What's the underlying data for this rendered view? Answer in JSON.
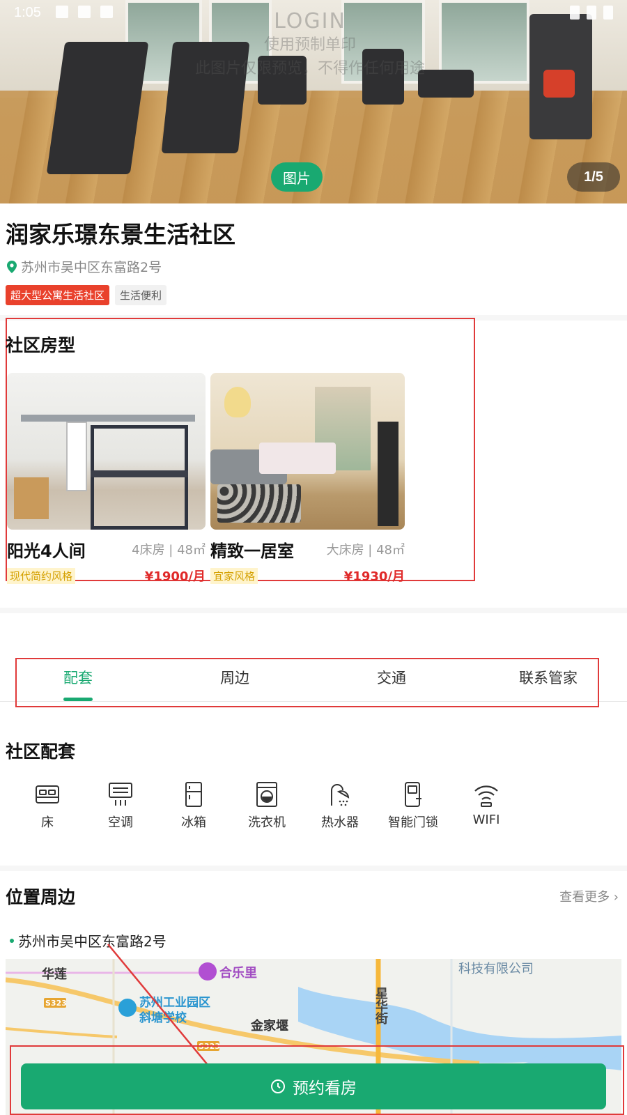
{
  "status_bar": {
    "time": "1:05"
  },
  "hero": {
    "watermark_line1": "LOGIN",
    "watermark_line2": "使用预制单印",
    "watermark_line3": "此图片仅限预览，不得作任何用途",
    "photo_label": "图片",
    "counter": "1/5"
  },
  "property": {
    "name": "润家乐璟东景生活社区",
    "address": "苏州市吴中区东富路2号",
    "tags": [
      "超大型公寓生活社区",
      "生活便利"
    ]
  },
  "room_types": {
    "title": "社区房型",
    "rooms": [
      {
        "name": "阳光4人间",
        "spec": "4床房 | 48㎡",
        "style": "现代简约风格",
        "price": "¥1900/月"
      },
      {
        "name": "精致一居室",
        "spec": "大床房 | 48㎡",
        "style": "宜家风格",
        "price": "¥1930/月"
      }
    ]
  },
  "tabs": [
    "配套",
    "周边",
    "交通",
    "联系管家"
  ],
  "facilities": {
    "title": "社区配套",
    "items": [
      {
        "label": "床",
        "icon": "bed-icon"
      },
      {
        "label": "空调",
        "icon": "air-conditioner-icon"
      },
      {
        "label": "冰箱",
        "icon": "fridge-icon"
      },
      {
        "label": "洗衣机",
        "icon": "washing-machine-icon"
      },
      {
        "label": "热水器",
        "icon": "shower-icon"
      },
      {
        "label": "智能门锁",
        "icon": "smart-lock-icon"
      },
      {
        "label": "WIFI",
        "icon": "wifi-icon"
      }
    ]
  },
  "location": {
    "title": "位置周边",
    "see_more": "查看更多 ›",
    "address": "苏州市吴中区东富路2号",
    "map_labels": {
      "huali": "华莲",
      "helelli": "合乐里",
      "company": "科技有限公司",
      "school_line1": "苏州工业园区",
      "school_line2": "斜塘学校",
      "jinjiayan": "金家堰",
      "xinghua": "星华街",
      "road1": "S323",
      "road2": "S323"
    }
  },
  "booking": {
    "label": "预约看房"
  },
  "colors": {
    "brand_green": "#19a971",
    "price_red": "#e02a2a",
    "tag_red": "#e9412c",
    "annotation_red": "#e03a3a"
  }
}
